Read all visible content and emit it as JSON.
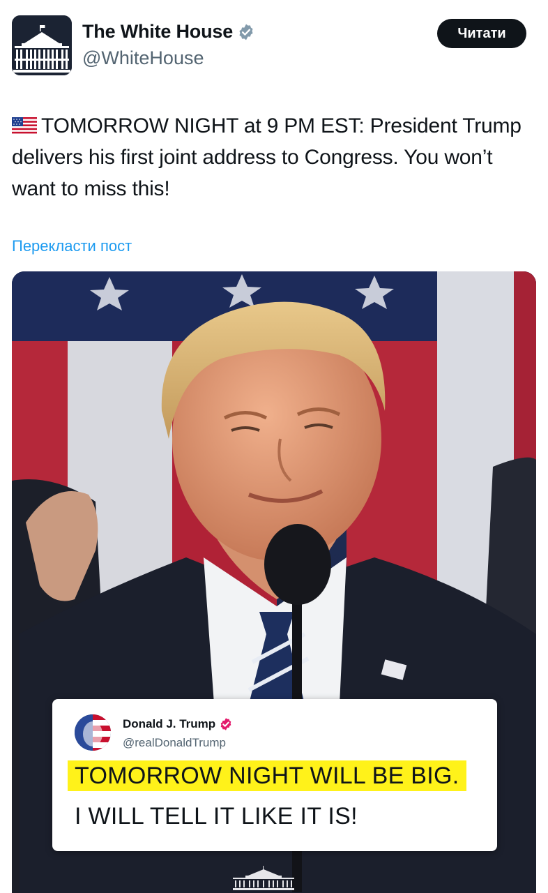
{
  "account": {
    "display_name": "The White House",
    "handle": "@WhiteHouse",
    "verified_icon": "verified-badge-icon"
  },
  "header": {
    "read_label": "Читати"
  },
  "post": {
    "flag_icon": "us-flag-emoji",
    "text": "TOMORROW NIGHT at 9 PM EST: President Trump delivers his first joint address to Congress. You won’t want to miss this!",
    "translate_label": "Перекласти пост"
  },
  "media": {
    "quote": {
      "name": "Donald J. Trump",
      "handle": "@realDonaldTrump",
      "line1": "TOMORROW NIGHT WILL BE BIG.",
      "line2": "I WILL TELL IT LIKE IT IS!"
    }
  },
  "colors": {
    "link": "#1d9bf0",
    "button_bg": "#0f1419",
    "highlight": "#fff21a",
    "handle_gray": "#536471"
  }
}
